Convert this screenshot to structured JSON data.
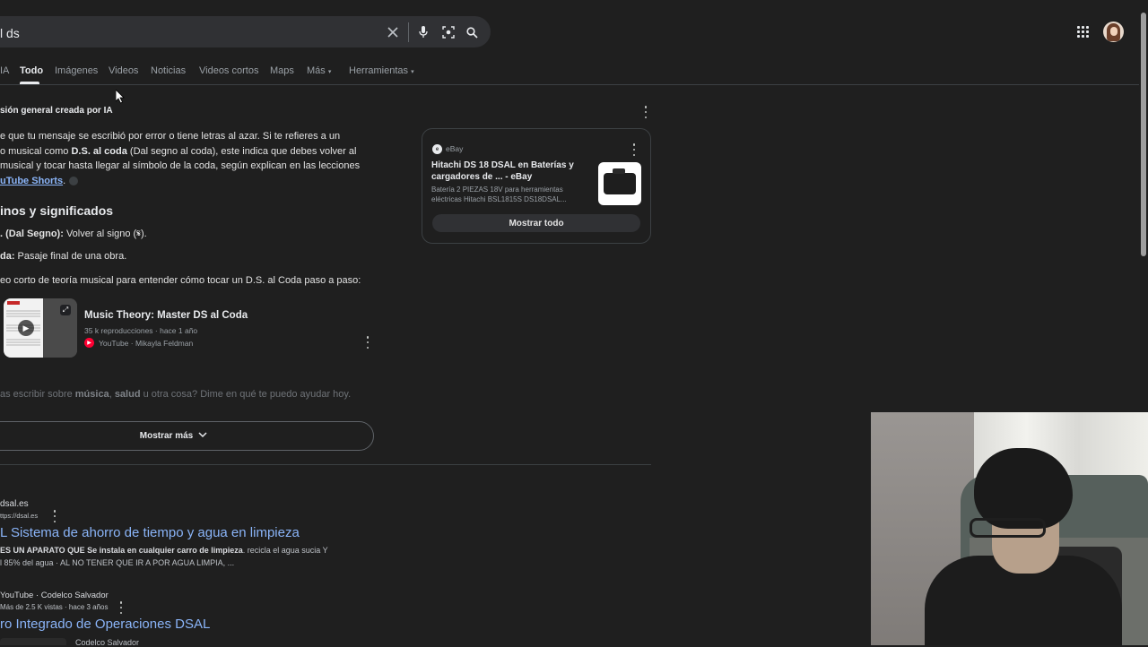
{
  "search": {
    "query": "l ds"
  },
  "tabs": [
    {
      "label": "IA"
    },
    {
      "label": "Todo"
    },
    {
      "label": "Imágenes"
    },
    {
      "label": "Videos"
    },
    {
      "label": "Noticias"
    },
    {
      "label": "Videos cortos"
    },
    {
      "label": "Maps"
    },
    {
      "label": "Más"
    },
    {
      "label": "Herramientas"
    }
  ],
  "ai_overview": {
    "title": "sión general creada por IA",
    "para_l1": "e que tu mensaje se escribió por error o tiene letras al azar. Si te refieres a un",
    "para_l2a": "o musical como ",
    "para_l2b": "D.S. al coda",
    "para_l2c": " (Dal segno al coda), este indica que debes volver al",
    "para_l3": "musical y tocar hasta llegar al símbolo de la coda, según explican en las lecciones",
    "para_l4_link": "uTube Shorts",
    "para_l4_end": ".",
    "heading_terms": "inos y significados",
    "term1_label": ". (Dal Segno):",
    "term1_text": " Volver al signo (𝄋).",
    "term2_label": "da:",
    "term2_text": " Pasaje final de una obra.",
    "video_intro": "eo corto de teoría musical para entender cómo tocar un D.S. al Coda paso a paso:",
    "video": {
      "title": "Music Theory: Master DS al Coda",
      "meta": "35 k reproducciones · hace 1 año",
      "source": "YouTube · Mikayla Feldman"
    },
    "followup_a": "as escribir sobre ",
    "followup_b1": "música",
    "followup_c": ", ",
    "followup_b2": "salud",
    "followup_d": " u otra cosa? Dime en qué te puedo ayudar hoy.",
    "show_more": "Mostrar más"
  },
  "shopping_card": {
    "source": "eBay",
    "title": "Hitachi DS 18 DSAL en Baterías y cargadores de ... - eBay",
    "desc": "Batería 2 PIEZAS 18V para herramientas eléctricas Hitachi BSL1815S DS18DSAL...",
    "button": "Mostrar todo"
  },
  "results": [
    {
      "site": "dsal.es",
      "url": "ttps://dsal.es",
      "title": "L Sistema de ahorro de tiempo y agua en limpieza",
      "snippet_b": "ES UN APARATO QUE Se instala en cualquier carro de limpieza",
      "snippet_r": ". recicla el agua sucia Y",
      "snippet2": "l 85% del agua · AL NO TENER QUE IR A POR AGUA LIMPIA, ..."
    },
    {
      "site": "YouTube · Codelco Salvador",
      "meta": "Más de 2.5 K vistas · hace 3 años",
      "title": "ro Integrado de Operaciones DSAL",
      "channel": "Codelco Salvador"
    }
  ],
  "colors": {
    "background": "#1f1f1f",
    "link": "#8ab4f8",
    "text": "#e3e3e3"
  }
}
